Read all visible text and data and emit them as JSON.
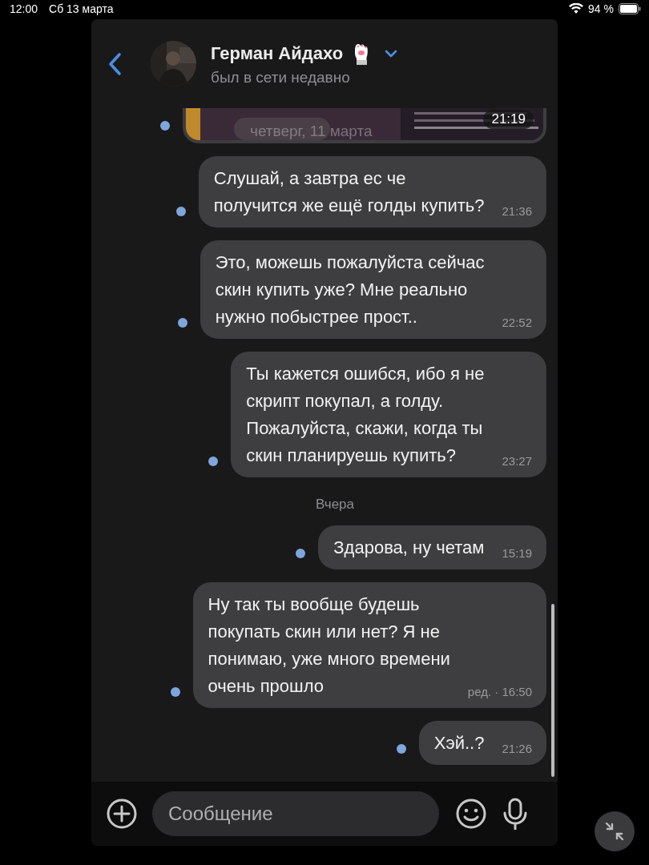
{
  "status_bar": {
    "time": "12:00",
    "date": "Сб 13 марта",
    "battery": "94 %"
  },
  "header": {
    "name": "Герман Айдахо",
    "subtitle": "был в сети недавно"
  },
  "floating_date": "четверг, 11 марта",
  "messages": [
    {
      "kind": "picture",
      "time": "21:19",
      "unread": true
    },
    {
      "kind": "text",
      "text": "Слушай, а завтра ес че\nполучится же ещё голды купить?",
      "time": "21:36",
      "unread": true
    },
    {
      "kind": "text",
      "text": "Это, можешь пожалуйста сейчас\nскин купить уже? Мне реально\nнужно побыстрее прост..",
      "time": "22:52",
      "unread": true
    },
    {
      "kind": "text",
      "text": "Ты кажется ошибся, ибо я не\nскрипт покупал, а голду.\nПожалуйста, скажи, когда ты\nскин планируешь купить?",
      "time": "23:27",
      "unread": true
    },
    {
      "kind": "date",
      "text": "Вчера"
    },
    {
      "kind": "text",
      "text": "Здарова, ну четам",
      "time": "15:19",
      "unread": true
    },
    {
      "kind": "text",
      "text": "Ну так ты вообще будешь\nпокупать скин или нет? Я не\nпонимаю, уже много времени\nочень прошло",
      "time": "16:50",
      "edited": "ред. ·",
      "unread": true
    },
    {
      "kind": "text",
      "text": "Хэй..?",
      "time": "21:26",
      "unread": true
    }
  ],
  "composer": {
    "placeholder": "Сообщение"
  }
}
